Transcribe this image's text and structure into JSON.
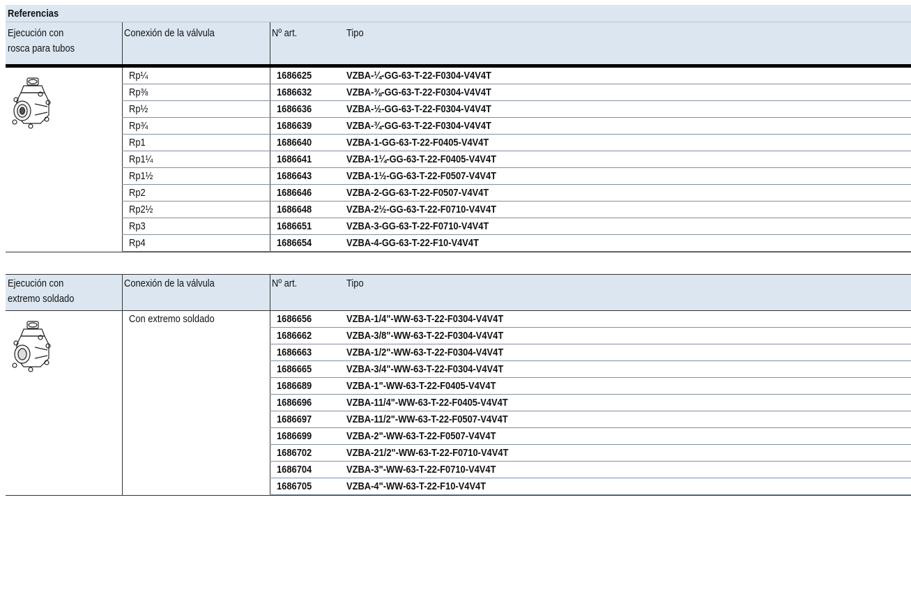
{
  "title": "Referencias",
  "headers": {
    "col1_line1": "Ejecución con",
    "col2": "Conexión de la válvula",
    "col3": "Nº art.",
    "col4": "Tipo"
  },
  "section1": {
    "col1_line2": "rosca para tubos",
    "rows": [
      {
        "conn": "Rp¼",
        "art": "1686625",
        "tipo": "VZBA-¼-GG-63-T-22-F0304-V4V4T"
      },
      {
        "conn": "Rp⅜",
        "art": "1686632",
        "tipo": "VZBA-⅜-GG-63-T-22-F0304-V4V4T"
      },
      {
        "conn": "Rp½",
        "art": "1686636",
        "tipo": "VZBA-½-GG-63-T-22-F0304-V4V4T"
      },
      {
        "conn": "Rp¾",
        "art": "1686639",
        "tipo": "VZBA-¾-GG-63-T-22-F0304-V4V4T"
      },
      {
        "conn": "Rp1",
        "art": "1686640",
        "tipo": "VZBA-1-GG-63-T-22-F0405-V4V4T"
      },
      {
        "conn": "Rp1¼",
        "art": "1686641",
        "tipo": "VZBA-1¼-GG-63-T-22-F0405-V4V4T"
      },
      {
        "conn": "Rp1½",
        "art": "1686643",
        "tipo": "VZBA-1½-GG-63-T-22-F0507-V4V4T"
      },
      {
        "conn": "Rp2",
        "art": "1686646",
        "tipo": "VZBA-2-GG-63-T-22-F0507-V4V4T"
      },
      {
        "conn": "Rp2½",
        "art": "1686648",
        "tipo": "VZBA-2½-GG-63-T-22-F0710-V4V4T"
      },
      {
        "conn": "Rp3",
        "art": "1686651",
        "tipo": "VZBA-3-GG-63-T-22-F0710-V4V4T"
      },
      {
        "conn": "Rp4",
        "art": "1686654",
        "tipo": "VZBA-4-GG-63-T-22-F10-V4V4T"
      }
    ]
  },
  "section2": {
    "col1_line2": "extremo soldado",
    "conn": "Con extremo soldado",
    "rows": [
      {
        "art": "1686656",
        "tipo": "VZBA-1/4\"-WW-63-T-22-F0304-V4V4T"
      },
      {
        "art": "1686662",
        "tipo": "VZBA-3/8\"-WW-63-T-22-F0304-V4V4T"
      },
      {
        "art": "1686663",
        "tipo": "VZBA-1/2\"-WW-63-T-22-F0304-V4V4T"
      },
      {
        "art": "1686665",
        "tipo": "VZBA-3/4\"-WW-63-T-22-F0304-V4V4T"
      },
      {
        "art": "1686689",
        "tipo": "VZBA-1\"-WW-63-T-22-F0405-V4V4T"
      },
      {
        "art": "1686696",
        "tipo": "VZBA-11/4\"-WW-63-T-22-F0405-V4V4T"
      },
      {
        "art": "1686697",
        "tipo": "VZBA-11/2\"-WW-63-T-22-F0507-V4V4T"
      },
      {
        "art": "1686699",
        "tipo": "VZBA-2\"-WW-63-T-22-F0507-V4V4T"
      },
      {
        "art": "1686702",
        "tipo": "VZBA-21/2\"-WW-63-T-22-F0710-V4V4T"
      },
      {
        "art": "1686704",
        "tipo": "VZBA-3\"-WW-63-T-22-F0710-V4V4T"
      },
      {
        "art": "1686705",
        "tipo": "VZBA-4\"-WW-63-T-22-F10-V4V4T"
      }
    ]
  },
  "icons": {
    "section1_image": "threaded-ball-valve-icon",
    "section2_image": "welded-ball-valve-icon"
  }
}
